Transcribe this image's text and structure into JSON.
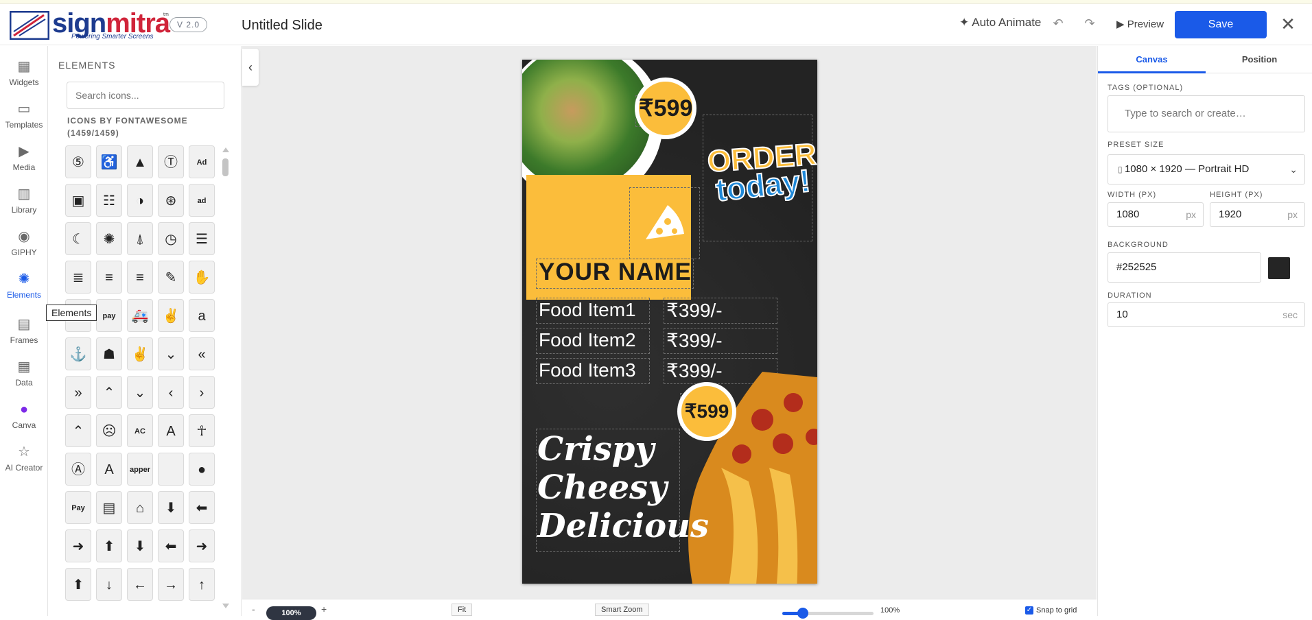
{
  "header": {
    "logo_word_a": "sign",
    "logo_word_b": "mitra",
    "logo_tagline": "Powering Smarter Screens",
    "logo_tm": "tm",
    "version": "V 2.0",
    "title": "Untitled Slide",
    "auto_animate": "Auto Animate",
    "preview": "Preview",
    "save": "Save"
  },
  "rail": {
    "items": [
      {
        "label": "Widgets",
        "icon": "widgets-icon"
      },
      {
        "label": "Templates",
        "icon": "templates-icon"
      },
      {
        "label": "Media",
        "icon": "media-icon"
      },
      {
        "label": "Library",
        "icon": "library-icon"
      },
      {
        "label": "GIPHY",
        "icon": "giphy-icon"
      },
      {
        "label": "Elements",
        "icon": "elements-icon"
      },
      {
        "label": "Frames",
        "icon": "frames-icon"
      },
      {
        "label": "Data",
        "icon": "data-icon"
      },
      {
        "label": "Canva",
        "icon": "canva-icon"
      },
      {
        "label": "AI Creator",
        "icon": "ai-creator-icon"
      }
    ],
    "active": "Elements",
    "tooltip": "Elements"
  },
  "panel": {
    "title": "ELEMENTS",
    "search_placeholder": "Search icons...",
    "subtitle_line1": "ICONS BY FONTAWESOME",
    "subtitle_line2": "(1459/1459)",
    "icons": [
      [
        "500px-icon",
        "accessible-icon",
        "accusoft-icon",
        "text-height-icon",
        "ad-icon"
      ],
      [
        "address-book-icon",
        "address-card-icon",
        "adjust-icon",
        "adversal-icon",
        "advertisement-icon"
      ],
      [
        "affiliatetheme-icon",
        "air-freshener-icon",
        "airbnb-icon",
        "alarm-clock-icon",
        "align-center-icon"
      ],
      [
        "align-justify-icon",
        "align-left-icon",
        "align-right-icon",
        "allergies-icon",
        "hand-icon"
      ],
      [
        "amazon-icon",
        "amazon-pay-icon",
        "ambulance-icon",
        "american-sign-icon",
        "amazon-a-icon"
      ],
      [
        "anchor-icon",
        "android-icon",
        "angellist-icon",
        "angle-double-down-icon",
        "angle-double-left-icon"
      ],
      [
        "angle-double-right-icon",
        "angle-double-up-icon",
        "angle-down-icon",
        "angle-left-icon",
        "angle-right-icon"
      ],
      [
        "angle-up-icon",
        "angry-icon",
        "angrycreative-icon",
        "angular-icon",
        "ankh-icon"
      ],
      [
        "app-store-icon",
        "app-store-ios-icon",
        "apper-icon",
        "apple-icon",
        "apple-alt-icon"
      ],
      [
        "apple-pay-icon",
        "archive-icon",
        "archway-icon",
        "arrow-circle-down-icon",
        "arrow-circle-left-icon"
      ],
      [
        "arrow-circle-right-icon",
        "arrow-circle-up-icon",
        "arrow-down-circle-icon",
        "arrow-left-circle-icon",
        "arrow-right-circle-icon"
      ],
      [
        "arrow-up-circle-icon",
        "arrow-down-icon",
        "arrow-left-icon",
        "arrow-right-icon",
        "arrow-up-icon"
      ]
    ],
    "glyphs": [
      [
        "⑤",
        "♿",
        "▲",
        "Ⓣ",
        "Ad"
      ],
      [
        "▣",
        "☷",
        "◑",
        "⊛",
        "ad"
      ],
      [
        "☾",
        "✺",
        "⍋",
        "◷",
        "☰"
      ],
      [
        "≣",
        "≡",
        "≡",
        "✎",
        "✋"
      ],
      [
        "a",
        "pay",
        "🚑",
        "✌",
        "a"
      ],
      [
        "⚓",
        "☗",
        "✌",
        "⌄",
        "«"
      ],
      [
        "»",
        "⌃",
        "⌄",
        "‹",
        "›"
      ],
      [
        "⌃",
        "☹",
        "AC",
        "A",
        "☥"
      ],
      [
        "Ⓐ",
        "A",
        "apper",
        "",
        "●"
      ],
      [
        "Pay",
        "▤",
        "⌂",
        "⬇",
        "⬅"
      ],
      [
        "➜",
        "⬆",
        "⬇",
        "⬅",
        "➜"
      ],
      [
        "⬆",
        "↓",
        "←",
        "→",
        "↑"
      ]
    ]
  },
  "slide": {
    "price_top": "₹599",
    "price_bottom": "₹599",
    "order_line1": "ORDER",
    "order_line2": "today!",
    "your_name": "YOUR NAME",
    "items": [
      {
        "name": "Food Item1",
        "price": "₹399/-"
      },
      {
        "name": "Food Item2",
        "price": "₹399/-"
      },
      {
        "name": "Food Item3",
        "price": "₹399/-"
      }
    ],
    "tagline": [
      "Crispy",
      "Cheesy",
      "Delicious"
    ],
    "colors": {
      "background": "#252525",
      "accent": "#fbbd3b",
      "blue": "#1e88d8"
    }
  },
  "bottombar": {
    "minus": "-",
    "zoom": "100%",
    "plus": "+",
    "fit": "Fit",
    "smart_zoom": "Smart Zoom",
    "slider_value": 0.23,
    "slider_pct": "100%",
    "snap": "Snap to grid"
  },
  "right": {
    "tabs": [
      "Canvas",
      "Position"
    ],
    "tags_label": "TAGS (OPTIONAL)",
    "tags_placeholder": "Type to search or create…",
    "preset_label": "PRESET SIZE",
    "preset_value": "1080 × 1920 — Portrait HD",
    "width_label": "WIDTH (PX)",
    "width_value": "1080",
    "height_label": "HEIGHT (PX)",
    "height_value": "1920",
    "px": "px",
    "background_label": "BACKGROUND",
    "background_value": "#252525",
    "duration_label": "DURATION",
    "duration_value": "10",
    "duration_unit": "sec"
  },
  "colors": {
    "primary": "#1a5ae8"
  }
}
